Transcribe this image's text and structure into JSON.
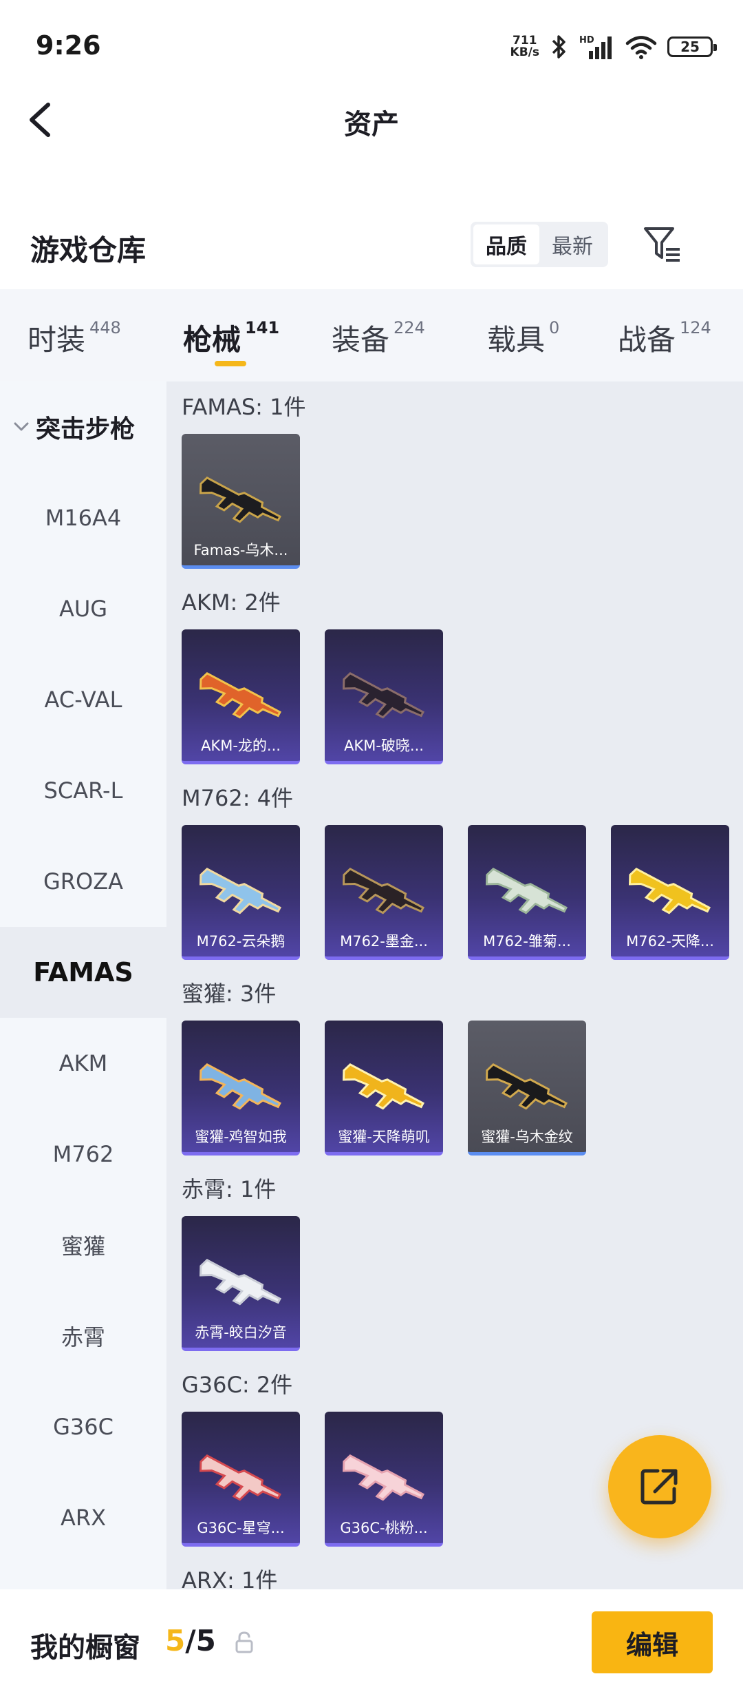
{
  "status": {
    "time": "9:26",
    "net_speed_value": "711",
    "net_speed_unit": "KB/s",
    "hd_label": "HD",
    "battery": "25"
  },
  "header": {
    "title": "资产"
  },
  "warehouse": {
    "title": "游戏仓库",
    "sort": {
      "quality": "品质",
      "newest": "最新"
    }
  },
  "tabs": [
    {
      "label": "时装",
      "count": "448"
    },
    {
      "label": "枪械",
      "count": "141"
    },
    {
      "label": "装备",
      "count": "224"
    },
    {
      "label": "载具",
      "count": "0"
    },
    {
      "label": "战备",
      "count": "124"
    }
  ],
  "sidebar": {
    "section": "突击步枪",
    "items": [
      "M16A4",
      "AUG",
      "AC-VAL",
      "SCAR-L",
      "GROZA",
      "FAMAS",
      "AKM",
      "M762",
      "蜜獾",
      "赤霄",
      "G36C",
      "ARX"
    ],
    "active": "FAMAS"
  },
  "groups": [
    {
      "title": "FAMAS: 1件",
      "items": [
        {
          "name": "Famas-乌木...",
          "style": "grey"
        }
      ]
    },
    {
      "title": "AKM: 2件",
      "items": [
        {
          "name": "AKM-龙的...",
          "style": "purple"
        },
        {
          "name": "AKM-破晓...",
          "style": "purple"
        }
      ]
    },
    {
      "title": "M762: 4件",
      "items": [
        {
          "name": "M762-云朵鹅",
          "style": "purple"
        },
        {
          "name": "M762-墨金...",
          "style": "purple"
        },
        {
          "name": "M762-雏菊...",
          "style": "purple"
        },
        {
          "name": "M762-天降...",
          "style": "purple"
        }
      ]
    },
    {
      "title": "蜜獾: 3件",
      "items": [
        {
          "name": "蜜獾-鸡智如我",
          "style": "purple"
        },
        {
          "name": "蜜獾-天降萌叽",
          "style": "purple"
        },
        {
          "name": "蜜獾-乌木金纹",
          "style": "grey"
        }
      ]
    },
    {
      "title": "赤霄: 1件",
      "items": [
        {
          "name": "赤霄-皎白汐音",
          "style": "purple"
        }
      ]
    },
    {
      "title": "G36C: 2件",
      "items": [
        {
          "name": "G36C-星穹...",
          "style": "purple"
        },
        {
          "name": "G36C-桃粉...",
          "style": "purple"
        }
      ]
    },
    {
      "title": "ARX: 1件",
      "items": []
    }
  ],
  "showcase": {
    "label": "我的橱窗",
    "current": "5",
    "separator": "/",
    "total": "5",
    "edit": "编辑"
  },
  "colors": {
    "accent": "#f9b51c",
    "card_purple": "#3a3272",
    "card_grey": "#4a4b55"
  },
  "icons": {
    "back": "chevron-left-icon",
    "filter": "filter-list-icon",
    "share": "external-link-icon",
    "lock": "lock-icon"
  }
}
